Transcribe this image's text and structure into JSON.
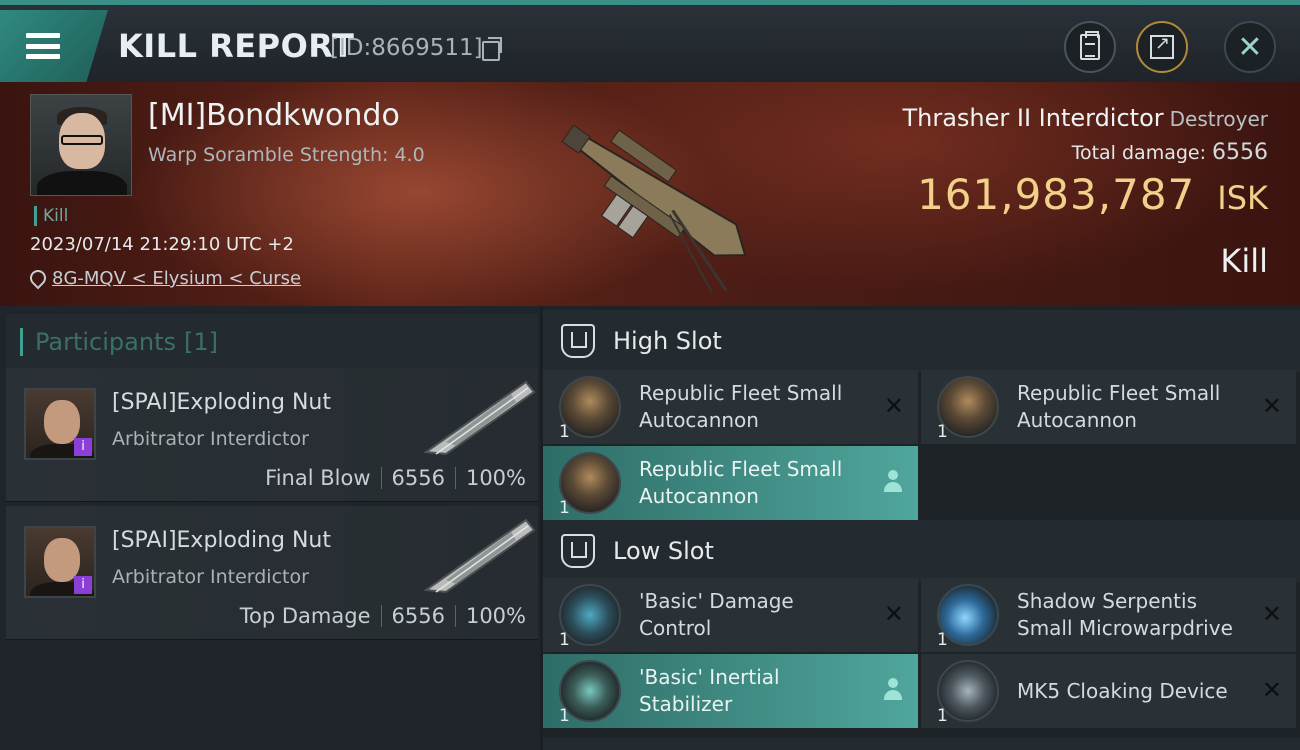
{
  "header": {
    "title": "KILL REPORT",
    "report_id": "[ID:8669511]"
  },
  "victim": {
    "name": "[MI]Bondkwondo",
    "warp_scramble": "Warp Soramble Strength: 4.0",
    "kill_tag": "Kill",
    "datetime": "2023/07/14 21:29:10 UTC +2",
    "location": "8G-MQV < Elysium < Curse",
    "ship_name": "Thrasher II Interdictor",
    "ship_class": "Destroyer",
    "total_damage_label": "Total damage:",
    "total_damage": "6556",
    "isk_value": "161,983,787",
    "isk_unit": "ISK",
    "result_label": "Kill"
  },
  "participants": {
    "title": "Participants",
    "count": "[1]",
    "rows": [
      {
        "name": "[SPAI]Exploding Nut",
        "ship": "Arbitrator Interdictor",
        "role": "Final Blow",
        "damage": "6556",
        "percent": "100%"
      },
      {
        "name": "[SPAI]Exploding Nut",
        "ship": "Arbitrator Interdictor",
        "role": "Top Damage",
        "damage": "6556",
        "percent": "100%"
      }
    ]
  },
  "high_slot": {
    "title": "High Slot",
    "modules": [
      {
        "qty": "1",
        "name_line1": "Republic Fleet Small",
        "name_line2": "Autocannon",
        "icon": "autocannon-icon"
      },
      {
        "qty": "1",
        "name_line1": "Republic Fleet Small",
        "name_line2": "Autocannon",
        "icon": "autocannon-icon"
      },
      {
        "qty": "1",
        "name_line1": "Republic Fleet Small",
        "name_line2": "Autocannon",
        "icon": "autocannon-icon"
      }
    ]
  },
  "low_slot": {
    "title": "Low Slot",
    "modules": [
      {
        "qty": "1",
        "name_line1": "'Basic' Damage",
        "name_line2": "Control",
        "icon": "damage-control-icon"
      },
      {
        "qty": "1",
        "name_line1": "Shadow Serpentis",
        "name_line2": "Small Microwarpdrive",
        "icon": "microwarpdrive-icon"
      },
      {
        "qty": "1",
        "name_line1": "'Basic' Inertial",
        "name_line2": "Stabilizer",
        "icon": "inertial-stabilizer-icon"
      },
      {
        "qty": "1",
        "name_line1": "MK5 Cloaking Device",
        "name_line2": "",
        "icon": "cloaking-device-icon"
      }
    ]
  },
  "colors": {
    "accent": "#3fa094",
    "isk": "#f1d08a",
    "highlight_row": "#4fa69c",
    "badge": "#8b3fd6"
  }
}
